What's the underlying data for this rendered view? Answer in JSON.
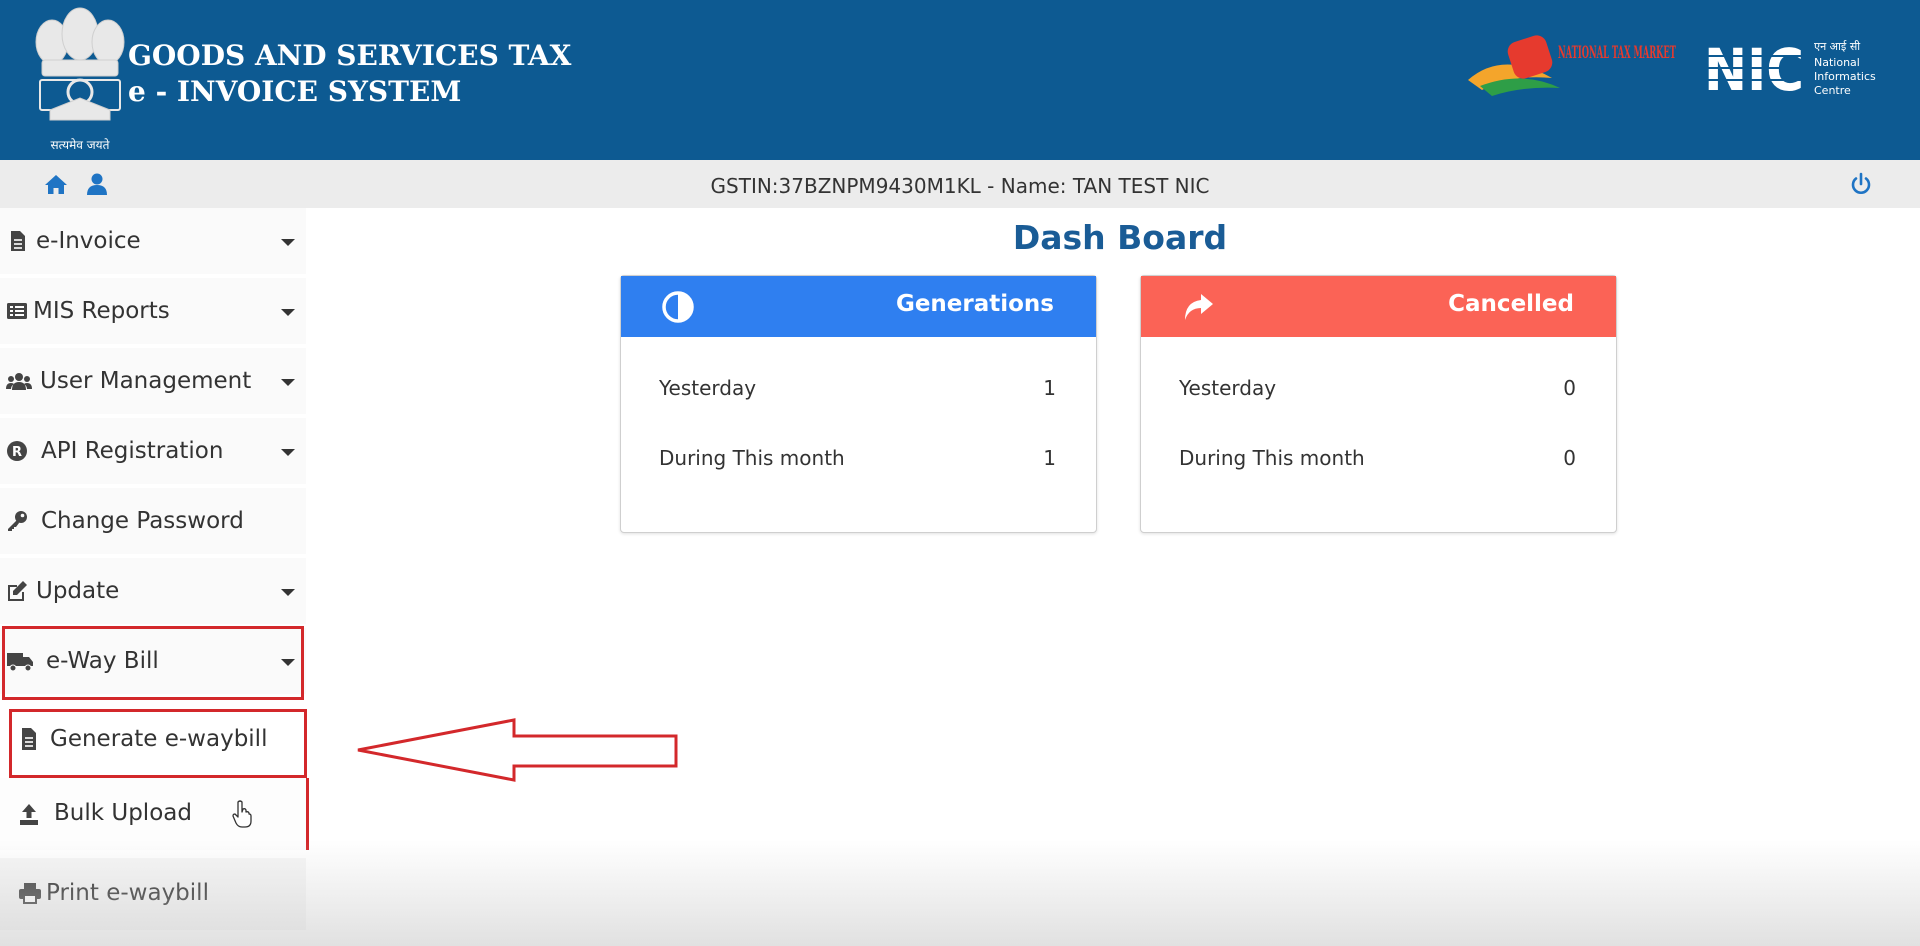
{
  "header": {
    "title_line1": "GOODS AND SERVICES TAX",
    "title_line2": "e - INVOICE SYSTEM",
    "emblem_caption": "सत्यमेव जयते",
    "logo_ntm_text": "NATIONAL TAX MARKET",
    "logo_nic_text": "NIC",
    "logo_nic_sub": "एन आई सी\nNational\nInformatics\nCentre"
  },
  "topbar": {
    "gstin_text": "GSTIN:37BZNPM9430M1KL - Name: TAN TEST NIC"
  },
  "sidebar": {
    "items": [
      {
        "label": "e-Invoice",
        "icon": "file-icon"
      },
      {
        "label": "MIS Reports",
        "icon": "list-icon"
      },
      {
        "label": "User Management",
        "icon": "users-icon"
      },
      {
        "label": "API Registration",
        "icon": "registered-icon"
      },
      {
        "label": "Change Password",
        "icon": "key-icon"
      },
      {
        "label": "Update",
        "icon": "edit-icon"
      },
      {
        "label": "e-Way Bill",
        "icon": "truck-icon"
      }
    ],
    "sub_items": [
      {
        "label": "Generate e-waybill",
        "icon": "file-icon"
      },
      {
        "label": "Bulk Upload",
        "icon": "upload-icon"
      },
      {
        "label": "Print e-waybill",
        "icon": "print-icon"
      }
    ]
  },
  "dashboard": {
    "title": "Dash Board",
    "cards": [
      {
        "title": "Generations",
        "color": "#2f7ff0",
        "icon": "half-circle-icon",
        "rows": [
          {
            "label": "Yesterday",
            "value": "1"
          },
          {
            "label": "During This month",
            "value": "1"
          }
        ]
      },
      {
        "title": "Cancelled",
        "color": "#fb6356",
        "icon": "share-arrow-icon",
        "rows": [
          {
            "label": "Yesterday",
            "value": "0"
          },
          {
            "label": "During This month",
            "value": "0"
          }
        ]
      }
    ]
  },
  "colors": {
    "header_bg": "#0d5a92",
    "highlight": "#d3282b",
    "title_blue": "#1a5c96"
  }
}
